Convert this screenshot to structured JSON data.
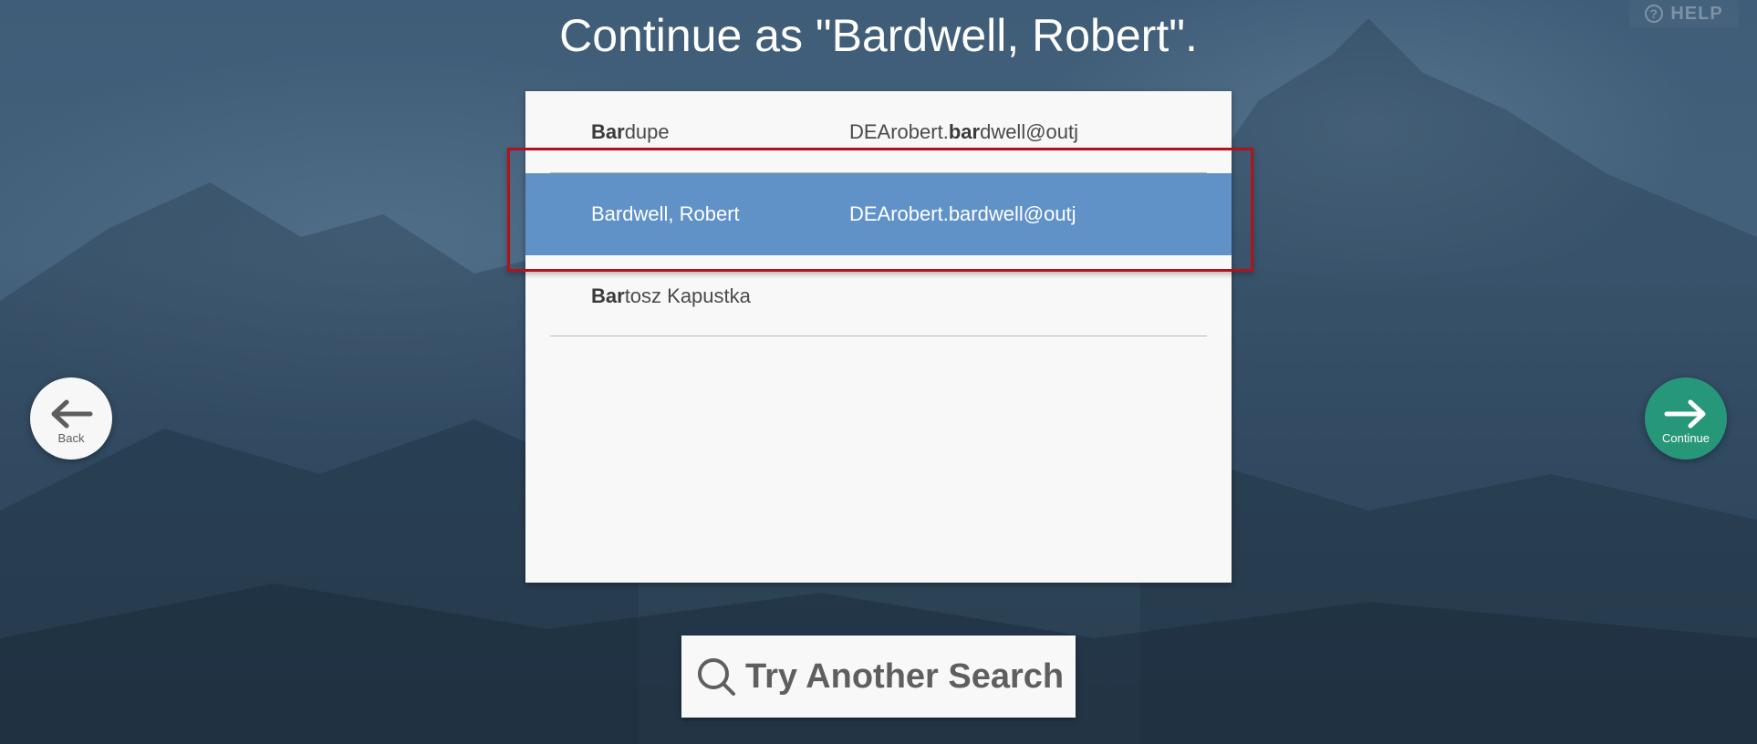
{
  "help": {
    "label": "HELP",
    "icon": "help-circle-icon"
  },
  "title": "Continue as \"Bardwell, Robert\".",
  "results": [
    {
      "name_bold": "Bar",
      "name_rest": "dupe",
      "email_pre": "DEArobert.",
      "email_bold": "bar",
      "email_post": "dwell@outj"
    },
    {
      "name_full": "Bardwell, Robert",
      "email_full": "DEArobert.bardwell@outj",
      "selected": true
    },
    {
      "name_bold": "Bar",
      "name_rest": "tosz Kapustka"
    }
  ],
  "nav": {
    "back_label": "Back",
    "continue_label": "Continue"
  },
  "search_button": {
    "label": "Try Another Search",
    "icon": "search-icon"
  },
  "colors": {
    "selected_row": "#6092c8",
    "continue": "#27977a",
    "highlight_border": "#b2121b"
  }
}
